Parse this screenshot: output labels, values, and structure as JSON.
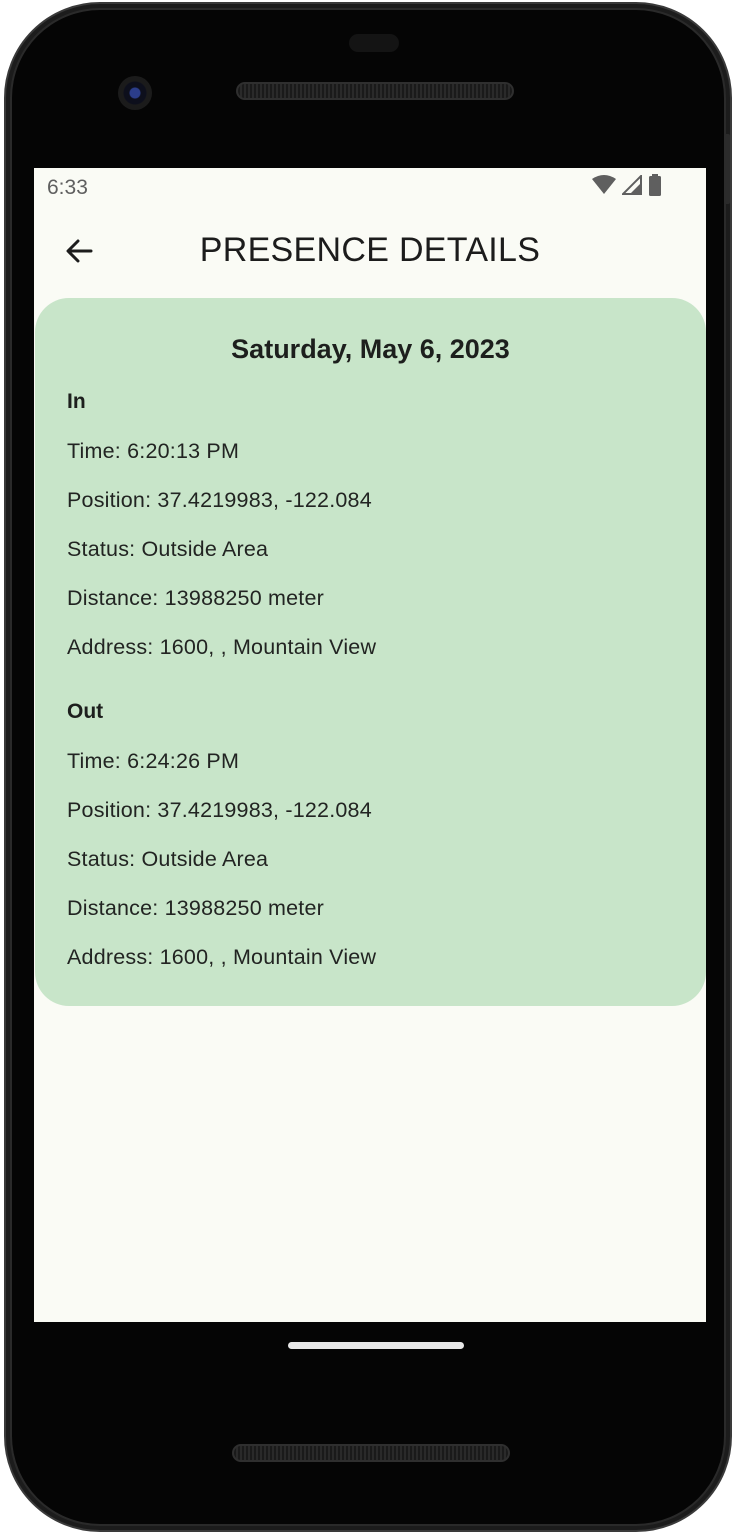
{
  "status_bar": {
    "time": "6:33",
    "icons": [
      "wifi-icon",
      "cellular-signal-icon",
      "battery-icon"
    ]
  },
  "app_bar": {
    "back_icon": "arrow-left-icon",
    "title": "PRESENCE DETAILS"
  },
  "card": {
    "date": "Saturday, May 6, 2023",
    "background": "#c8e5c9",
    "sections": [
      {
        "heading": "In",
        "time": "Time: 6:20:13 PM",
        "position": "Position: 37.4219983, -122.084",
        "status": "Status: Outside Area",
        "distance": "Distance: 13988250 meter",
        "address": "Address: 1600, , Mountain View"
      },
      {
        "heading": "Out",
        "time": "Time: 6:24:26 PM",
        "position": "Position: 37.4219983, -122.084",
        "status": "Status: Outside Area",
        "distance": "Distance: 13988250 meter",
        "address": "Address: 1600, , Mountain View"
      }
    ]
  },
  "colors": {
    "screen_background": "#fafbf5",
    "card_background": "#c8e5c9",
    "text": "#1d1f1d"
  }
}
